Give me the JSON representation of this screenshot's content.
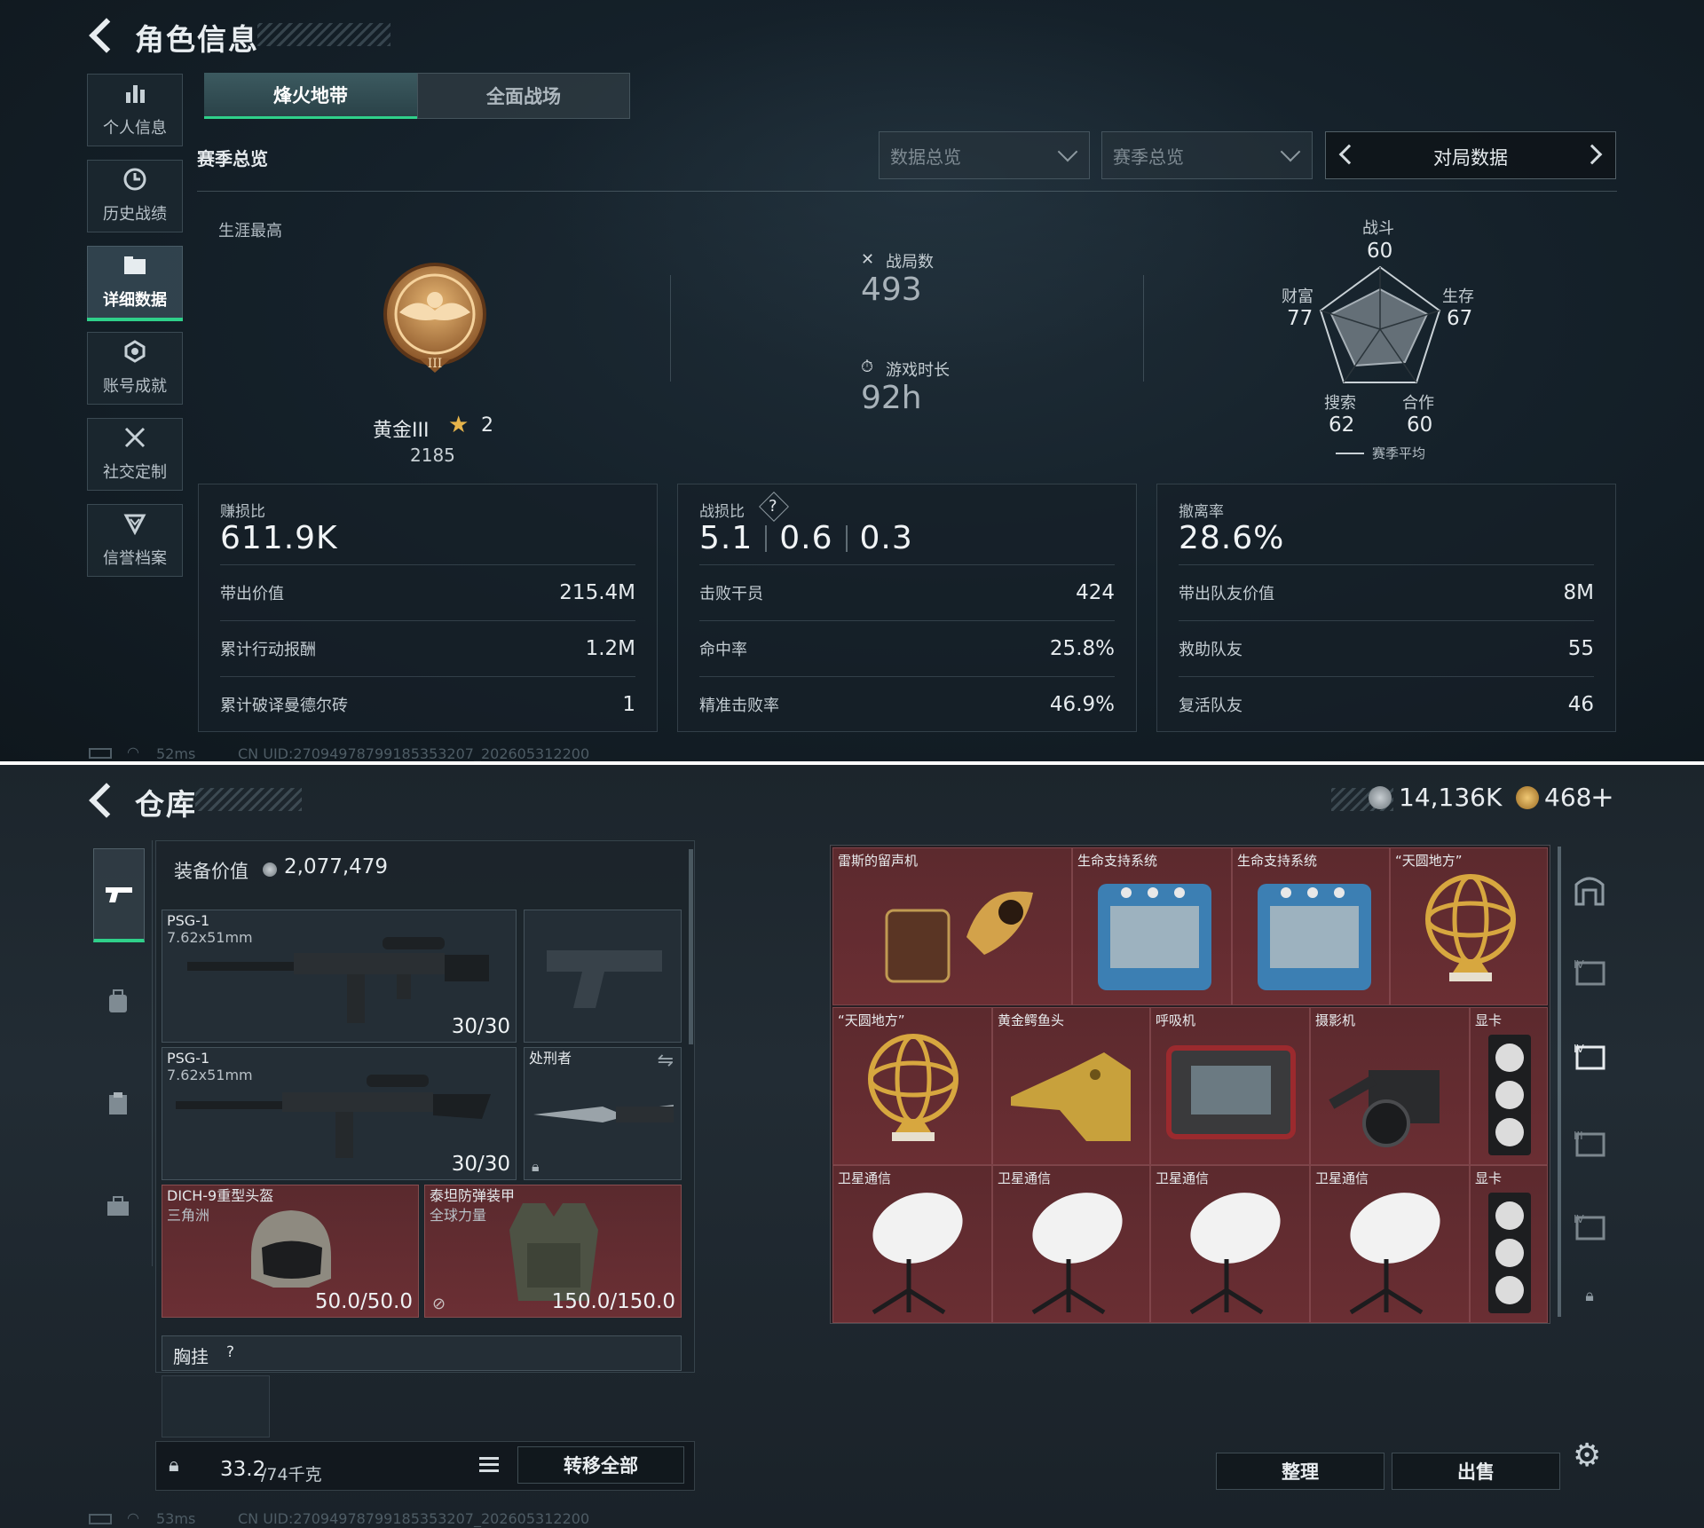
{
  "top": {
    "title": "角色信息",
    "sidebar": [
      {
        "label": "个人信息",
        "icon": "bar-chart-icon"
      },
      {
        "label": "历史战绩",
        "icon": "clock-icon"
      },
      {
        "label": "详细数据",
        "icon": "folder-icon"
      },
      {
        "label": "账号成就",
        "icon": "badge-icon"
      },
      {
        "label": "社交定制",
        "icon": "tools-icon"
      },
      {
        "label": "信誉档案",
        "icon": "shield-icon"
      }
    ],
    "tabs": [
      "烽火地带",
      "全面战场"
    ],
    "section_title": "赛季总览",
    "dropdown1": "数据总览",
    "dropdown2": "赛季总览",
    "pager_label": "对局数据",
    "career_label": "生涯最高",
    "rank_name": "黄金III",
    "rank_stars": "2",
    "rank_points": "2185",
    "matches_label": "战局数",
    "matches_value": "493",
    "playtime_label": "游戏时长",
    "playtime_value": "92h",
    "radar": {
      "combat_label": "战斗",
      "combat_value": "60",
      "survive_label": "生存",
      "survive_value": "67",
      "coop_label": "合作",
      "coop_value": "60",
      "search_label": "搜索",
      "search_value": "62",
      "wealth_label": "财富",
      "wealth_value": "77",
      "legend": "赛季平均"
    },
    "cards": [
      {
        "title": "赚损比",
        "big": "611.9K",
        "rows": [
          {
            "k": "带出价值",
            "v": "215.4M"
          },
          {
            "k": "累计行动报酬",
            "v": "1.2M"
          },
          {
            "k": "累计破译曼德尔砖",
            "v": "1"
          }
        ]
      },
      {
        "title": "战损比",
        "big_parts": [
          "5.1",
          "0.6",
          "0.3"
        ],
        "rows": [
          {
            "k": "击败干员",
            "v": "424"
          },
          {
            "k": "命中率",
            "v": "25.8%"
          },
          {
            "k": "精准击败率",
            "v": "46.9%"
          }
        ]
      },
      {
        "title": "撤离率",
        "big": "28.6%",
        "rows": [
          {
            "k": "带出队友价值",
            "v": "8M"
          },
          {
            "k": "救助队友",
            "v": "55"
          },
          {
            "k": "复活队友",
            "v": "46"
          }
        ]
      }
    ],
    "ping": "52ms",
    "uid": "CN UID:2709497879918535320​7_202605312200"
  },
  "bottom": {
    "title": "仓库",
    "currency1": "14,136K",
    "currency2": "468",
    "equip_value_label": "装备价值",
    "equip_value": "2,077,479",
    "weapons": [
      {
        "name": "PSG-1",
        "ammo": "7.62x51mm",
        "count": "30/30"
      },
      {
        "name": "PSG-1",
        "ammo": "7.62x51mm",
        "count": "30/30"
      }
    ],
    "melee": "处刑者",
    "helmet": {
      "name": "DICH-9重型头盔",
      "sub": "三角洲",
      "dur": "50.0/50.0"
    },
    "armor": {
      "name": "泰坦防弹装甲",
      "sub": "全球力量",
      "dur": "150.0/150.0"
    },
    "chest_label": "胸挂",
    "weight": "33.2",
    "weight_max": "/74千克",
    "transfer_all": "转移全部",
    "sort_btn": "整理",
    "sell_btn": "出售",
    "items": [
      "雷斯的留声机",
      "生命支持系统",
      "生命支持系统",
      "“天圆地方”",
      "“天圆地方”",
      "黄金鳄鱼头",
      "呼吸机",
      "摄影机",
      "显卡",
      "卫星通信",
      "卫星通信",
      "卫星通信",
      "卫星通信",
      "显卡"
    ],
    "ping": "53ms",
    "uid": "CN UID:2709497879918535320​7_202605312200"
  }
}
